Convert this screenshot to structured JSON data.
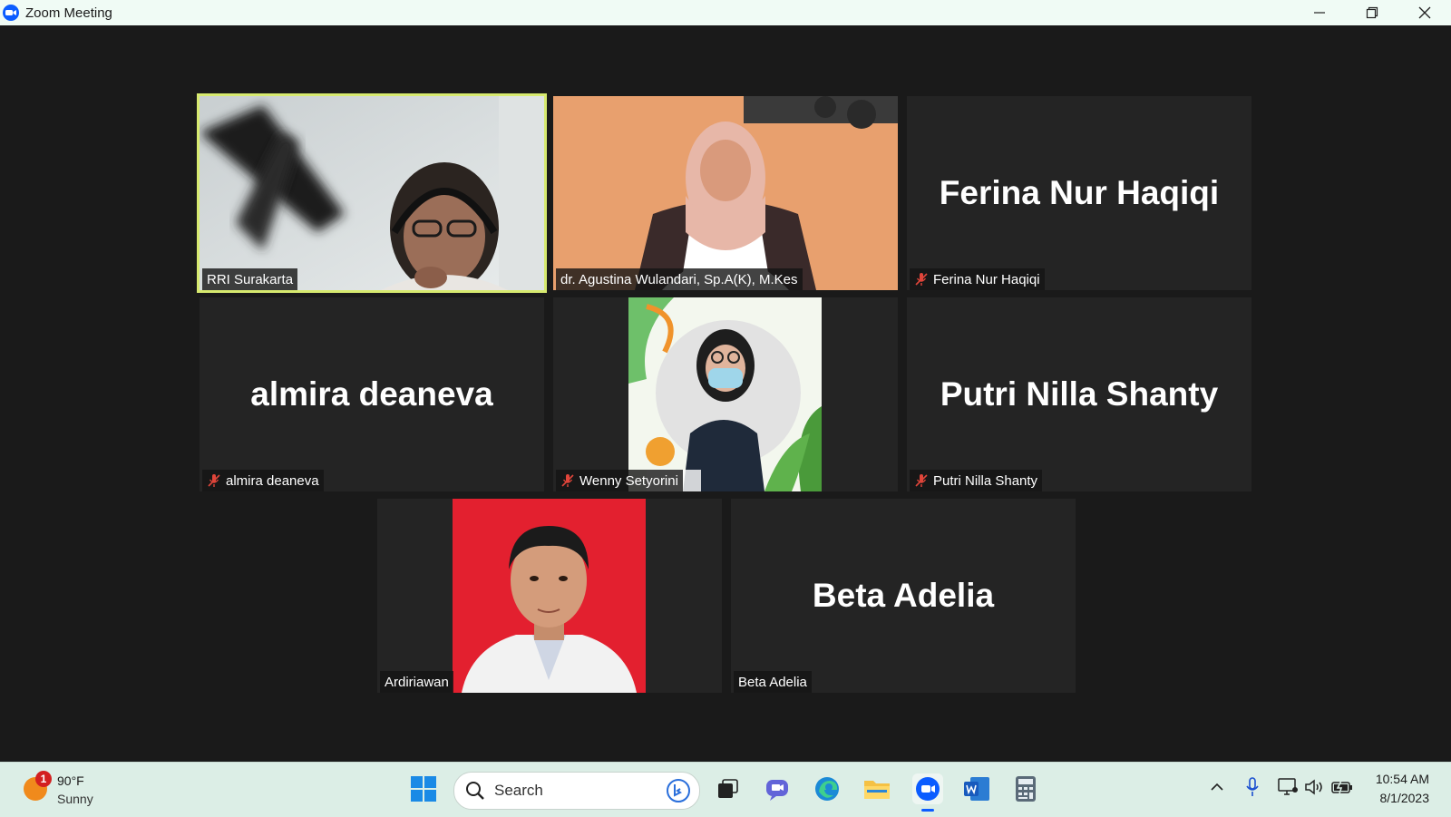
{
  "window": {
    "title": "Zoom Meeting"
  },
  "participants": [
    {
      "name": "RRI Surakarta",
      "video": true,
      "active_speaker": true,
      "muted": false
    },
    {
      "name": "dr. Agustina Wulandari, Sp.A(K), M.Kes",
      "video": true,
      "muted": false
    },
    {
      "name": "Ferina Nur Haqiqi",
      "video": false,
      "muted": true
    },
    {
      "name": "almira deaneva",
      "video": false,
      "muted": true
    },
    {
      "name": "Wenny Setyorini",
      "video": true,
      "muted": true
    },
    {
      "name": "Putri Nilla Shanty",
      "video": false,
      "muted": true
    },
    {
      "name": "Ardiriawan",
      "video": true,
      "muted": false
    },
    {
      "name": "Beta Adelia",
      "video": false,
      "muted": false
    }
  ],
  "taskbar": {
    "weather": {
      "temp": "90°F",
      "condition": "Sunny",
      "notification_count": "1"
    },
    "search_placeholder": "Search",
    "apps": [
      "windows-start-icon",
      "bing-icon",
      "task-view-icon",
      "teams-chat-icon",
      "edge-icon",
      "file-explorer-icon",
      "zoom-icon",
      "word-icon",
      "calculator-icon"
    ],
    "time": "10:54 AM",
    "date": "8/1/2023"
  },
  "colors": {
    "active_speaker_border": "#d7ea6f",
    "muted_icon": "#e0453a",
    "zoom_blue": "#0b5cff"
  }
}
